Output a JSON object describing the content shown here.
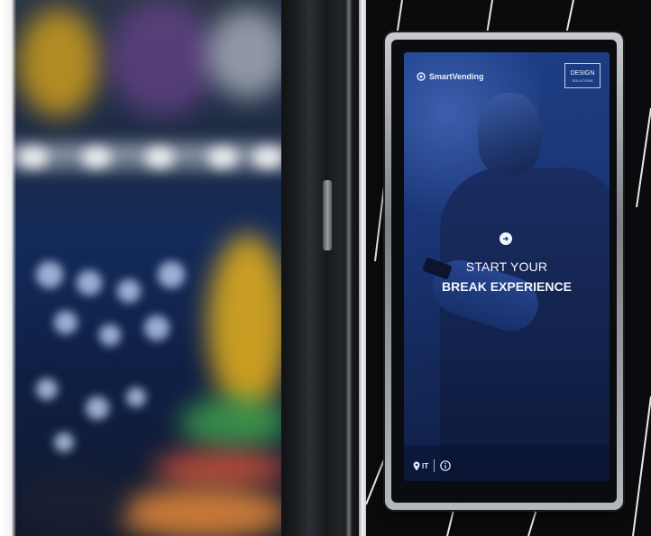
{
  "screen": {
    "brand_name": "SmartVending",
    "badge_line1": "DESIGN",
    "badge_line2": "SOLUTIONS",
    "headline_line1": "START YOUR",
    "headline_line2": "BREAK EXPERIENCE",
    "language_code": "IT",
    "icons": {
      "brand": "brand-logo-icon",
      "arrow": "arrow-right-icon",
      "location": "location-pin-icon",
      "info": "info-icon"
    }
  },
  "colors": {
    "screen_blue": "#1a3575",
    "panel_black": "#0b0b0d",
    "text_white": "#f3f6ff"
  }
}
